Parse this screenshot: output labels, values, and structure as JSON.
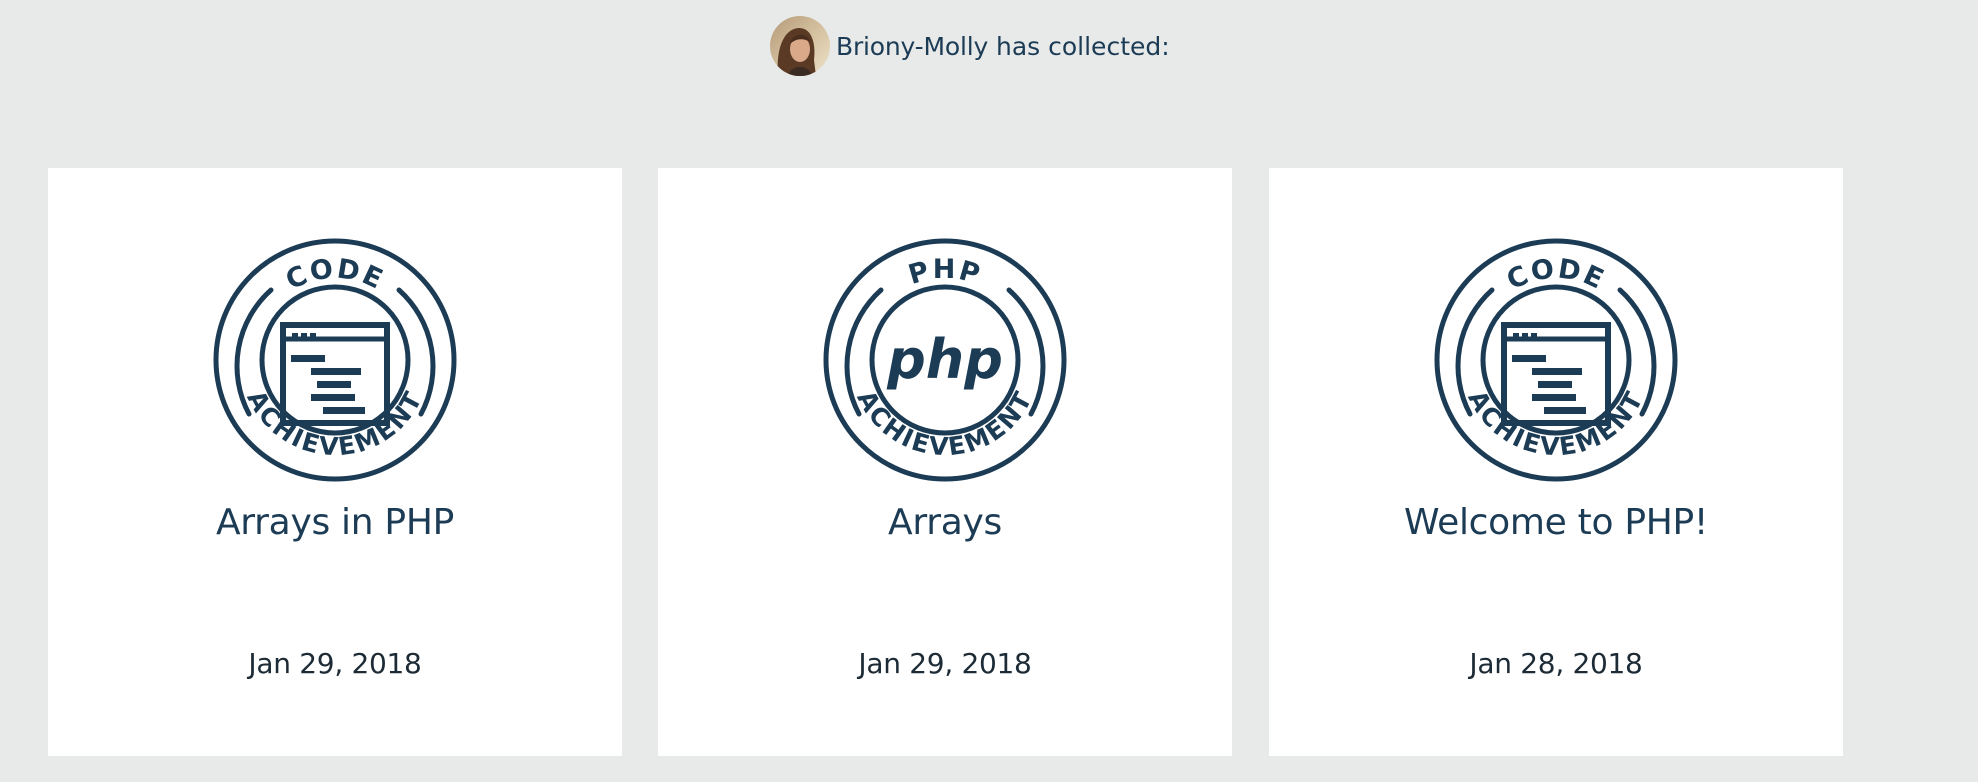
{
  "header": {
    "user_name": "Briony-Molly",
    "suffix": " has collected:",
    "avatar_icon": "user-avatar"
  },
  "colors": {
    "background": "#e8eaea",
    "card": "#ffffff",
    "badge_navy": "#1c3b55"
  },
  "achievements": [
    {
      "title": "Arrays in PHP",
      "date": "Jan 29, 2018",
      "badge": {
        "top_text": "CODE",
        "bottom_text": "ACHIEVEMENT",
        "icon": "code-window-icon"
      }
    },
    {
      "title": "Arrays",
      "date": "Jan 29, 2018",
      "badge": {
        "top_text": "PHP",
        "bottom_text": "ACHIEVEMENT",
        "icon": "php-logo-icon",
        "center_text": "php"
      }
    },
    {
      "title": "Welcome to PHP!",
      "date": "Jan 28, 2018",
      "badge": {
        "top_text": "CODE",
        "bottom_text": "ACHIEVEMENT",
        "icon": "code-window-icon"
      }
    }
  ]
}
